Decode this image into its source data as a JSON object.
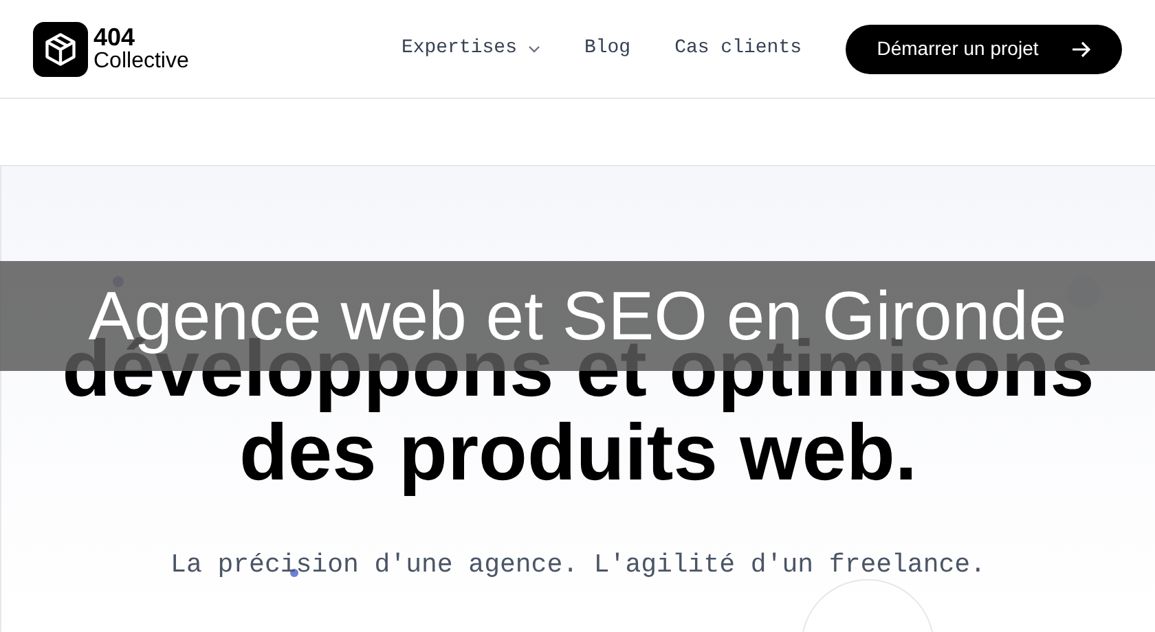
{
  "header": {
    "logo": {
      "line_1": "404",
      "line_2": "Collective"
    },
    "nav": [
      {
        "label": "Expertises",
        "kind": "dropdown"
      },
      {
        "label": "Blog",
        "kind": "link"
      },
      {
        "label": "Cas clients",
        "kind": "link"
      }
    ],
    "cta": {
      "label": "Démarrer un projet"
    }
  },
  "hero": {
    "heading_lines": [
      "développons et optimisons",
      "des produits web."
    ],
    "subtitle": "La précision d'une agence. L'agilité d'un freelance."
  },
  "overlay": {
    "caption": "Agence web et SEO en Gironde"
  }
}
